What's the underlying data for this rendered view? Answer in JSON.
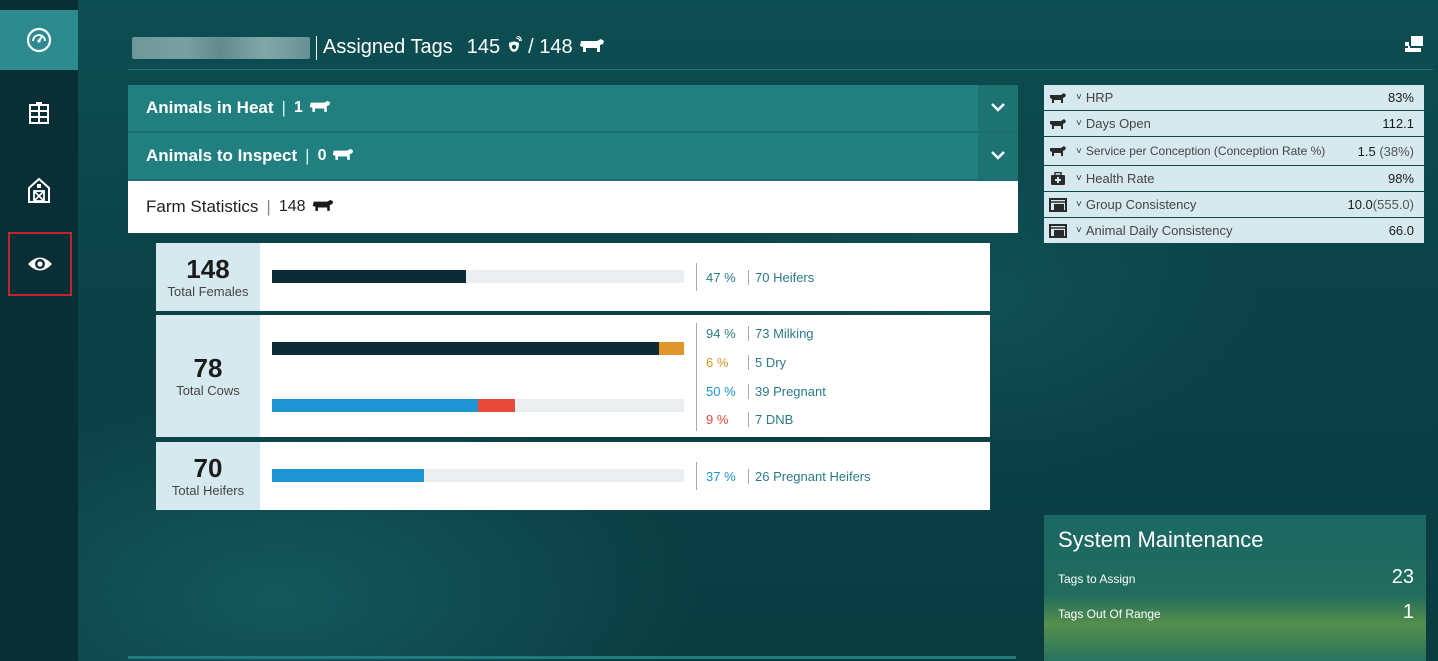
{
  "sidebar": {
    "items": [
      {
        "icon": "dashboard-icon"
      },
      {
        "icon": "building-icon"
      },
      {
        "icon": "barn-icon"
      },
      {
        "icon": "eye-icon"
      }
    ]
  },
  "header": {
    "title": "Assigned Tags",
    "tag_count": "145",
    "animal_count": "/ 148"
  },
  "accordions": [
    {
      "label": "Animals in Heat",
      "count": "1"
    },
    {
      "label": "Animals to Inspect",
      "count": "0"
    }
  ],
  "farm_stats": {
    "label": "Farm Statistics",
    "count": "148",
    "cards": [
      {
        "number": "148",
        "caption": "Total Females",
        "rows": [
          {
            "pct": "47 %",
            "label": "70 Heifers"
          }
        ]
      },
      {
        "number": "78",
        "caption": "Total Cows",
        "rows": [
          {
            "pct": "94 %",
            "label": "73 Milking"
          },
          {
            "pct": "6 %",
            "label": "5 Dry"
          },
          {
            "pct": "50 %",
            "label": "39 Pregnant"
          },
          {
            "pct": "9 %",
            "label": "7 DNB"
          }
        ]
      },
      {
        "number": "70",
        "caption": "Total Heifers",
        "rows": [
          {
            "pct": "37 %",
            "label": "26 Pregnant Heifers"
          }
        ]
      }
    ]
  },
  "bars": {
    "females_heifers": 0.47,
    "cows_milking": 0.94,
    "cows_dry": 0.06,
    "cows_pregnant": 0.5,
    "cows_dnb": 0.09,
    "heifers_pregnant": 0.37
  },
  "kpis": [
    {
      "label": "HRP",
      "value": "83%",
      "sub": "",
      "icon": "cow-group-icon"
    },
    {
      "label": "Days Open",
      "value": "112.1",
      "sub": "",
      "icon": "cow-group-icon"
    },
    {
      "label": "Service per Conception (Conception Rate %)",
      "value": "1.5",
      "sub": "(38%)",
      "icon": "cow-group-icon"
    },
    {
      "label": "Health Rate",
      "value": "98%",
      "sub": "",
      "icon": "medical-kit-icon"
    },
    {
      "label": "Group Consistency",
      "value": "10.0",
      "sub": "(555.0)",
      "icon": "feed-bin-icon"
    },
    {
      "label": "Animal Daily Consistency",
      "value": "66.0",
      "sub": "",
      "icon": "feed-bin-icon"
    }
  ],
  "system_maintenance": {
    "title": "System Maintenance",
    "rows": [
      {
        "label": "Tags to Assign",
        "value": "23"
      },
      {
        "label": "Tags Out Of Range",
        "value": "1"
      }
    ]
  },
  "colors": {
    "dark_bar": "#0d2a36",
    "dry_orange": "#e0962a",
    "pregnant_blue": "#1f94d2",
    "dnb_red": "#e84a3a",
    "teal_text": "#2a7b8a"
  }
}
